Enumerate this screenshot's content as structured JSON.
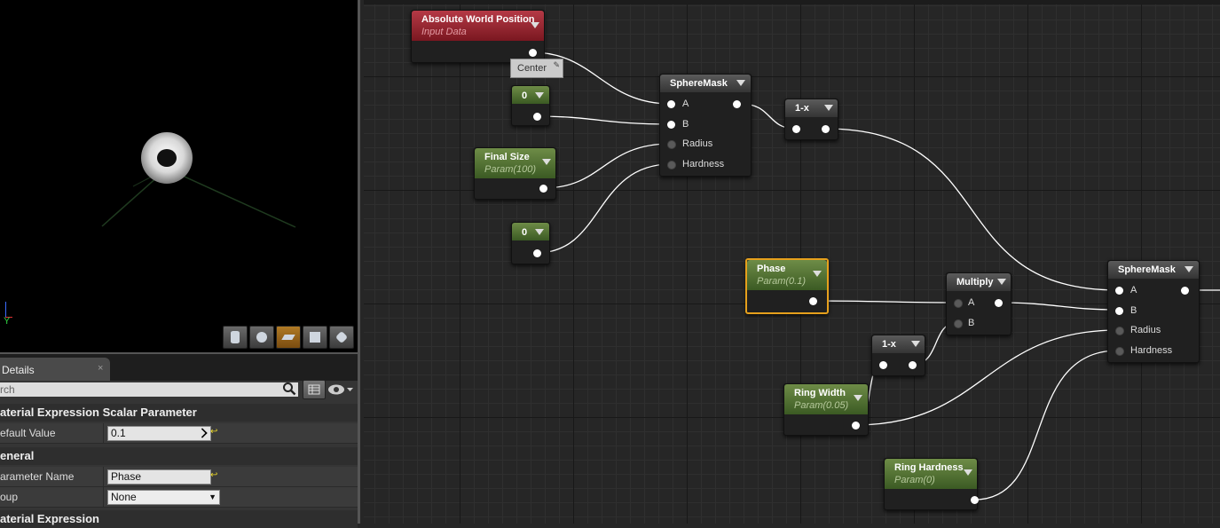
{
  "viewport": {
    "axis_label": "Y",
    "toolbar": [
      {
        "icon": "cylinder-icon",
        "active": false
      },
      {
        "icon": "sphere-icon",
        "active": false
      },
      {
        "icon": "plane-icon",
        "active": true
      },
      {
        "icon": "cube-icon",
        "active": false
      },
      {
        "icon": "custom-mesh-icon",
        "active": false
      }
    ]
  },
  "details": {
    "tab_label": "Details",
    "tab_close": "×",
    "search_placeholder": "rch",
    "sections": {
      "scalar_param": "aterial Expression Scalar Parameter",
      "general": "eneral",
      "material_expression": "aterial Expression"
    },
    "rows": {
      "default_value": {
        "label": "efault Value",
        "value": "0.1"
      },
      "parameter_name": {
        "label": "arameter Name",
        "value": "Phase"
      },
      "group": {
        "label": "oup",
        "value": "None"
      }
    }
  },
  "graph": {
    "tooltip": "Center",
    "nodes": {
      "abs_world_pos": {
        "title": "Absolute World Position",
        "subtitle": "Input Data"
      },
      "const_center": {
        "title": "0"
      },
      "final_size": {
        "title": "Final Size",
        "subtitle": "Param(100)"
      },
      "const_hardness": {
        "title": "0"
      },
      "spheremask1": {
        "title": "SphereMask",
        "pins": [
          "A",
          "B",
          "Radius",
          "Hardness"
        ]
      },
      "oneminus1": {
        "title": "1-x"
      },
      "phase": {
        "title": "Phase",
        "subtitle": "Param(0.1)"
      },
      "multiply": {
        "title": "Multiply",
        "pins": [
          "A",
          "B"
        ]
      },
      "oneminus2": {
        "title": "1-x"
      },
      "ring_width": {
        "title": "Ring Width",
        "subtitle": "Param(0.05)"
      },
      "ring_hardness": {
        "title": "Ring Hardness",
        "subtitle": "Param(0)"
      },
      "spheremask2": {
        "title": "SphereMask",
        "pins": [
          "A",
          "B",
          "Radius",
          "Hardness"
        ]
      }
    }
  }
}
